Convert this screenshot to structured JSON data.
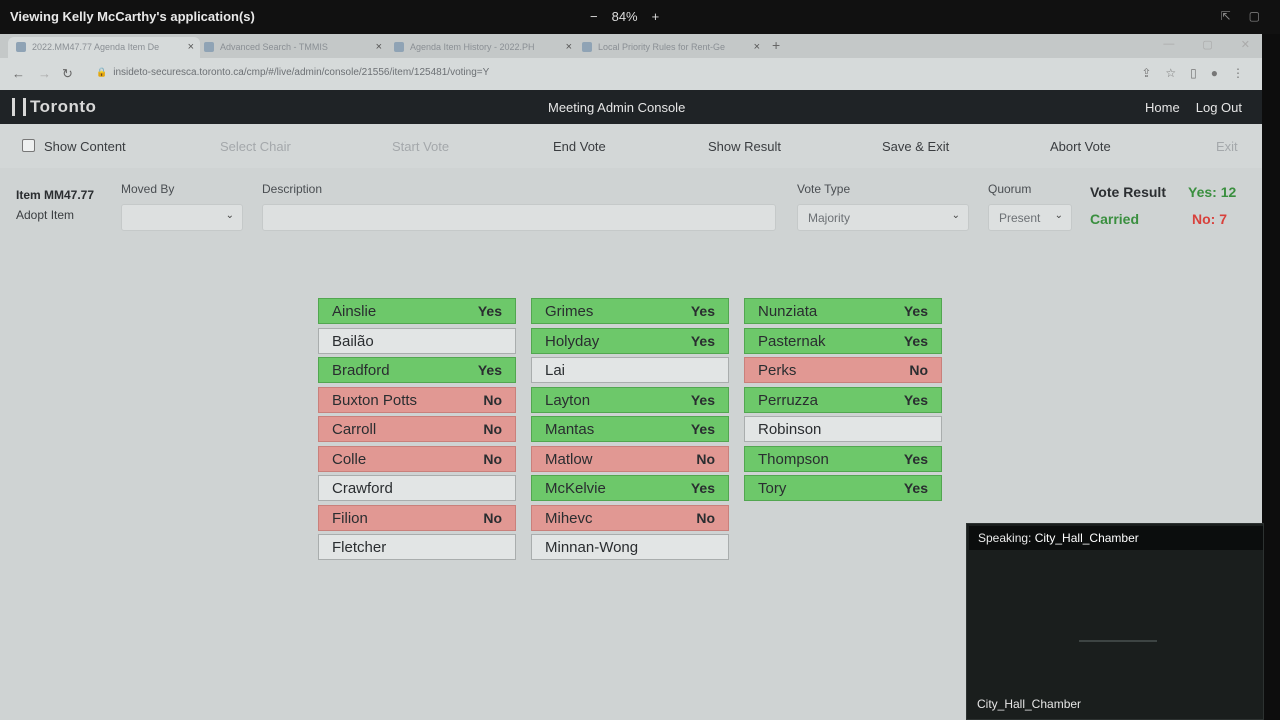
{
  "share": {
    "title": "Viewing Kelly McCarthy's application(s)",
    "zoom": "84%",
    "zoom_minus": "−",
    "zoom_plus": "+"
  },
  "browser": {
    "tabs": [
      {
        "label": "2022.MM47.77 Agenda Item De",
        "active": true
      },
      {
        "label": "Advanced Search - TMMIS",
        "active": false
      },
      {
        "label": "Agenda Item History - 2022.PH",
        "active": false
      },
      {
        "label": "Local Priority Rules for Rent-Ge",
        "active": false
      }
    ],
    "new_tab": "+",
    "url": "insideto-securesca.toronto.ca/cmp/#/live/admin/console/21556/item/125481/voting=Y"
  },
  "app": {
    "logo_text": "Toronto",
    "title": "Meeting Admin Console",
    "home_link": "Home",
    "logout_link": "Log Out"
  },
  "toolbar": {
    "show_content": "Show Content",
    "select_chair": "Select Chair",
    "start_vote": "Start Vote",
    "end_vote": "End Vote",
    "show_result": "Show Result",
    "save_exit": "Save & Exit",
    "abort_vote": "Abort Vote",
    "exit": "Exit"
  },
  "form": {
    "item_code": "Item MM47.77",
    "item_action": "Adopt Item",
    "moved_by_label": "Moved By",
    "moved_by_value": "",
    "description_label": "Description",
    "vote_type_label": "Vote Type",
    "vote_type_value": "Majority",
    "quorum_label": "Quorum",
    "quorum_value": "Present"
  },
  "result": {
    "label": "Vote Result",
    "status": "Carried",
    "yes": "Yes: 12",
    "no": "No: 7"
  },
  "votes": {
    "col1": [
      {
        "name": "Ainslie",
        "vote": "Yes"
      },
      {
        "name": "Bailão",
        "vote": ""
      },
      {
        "name": "Bradford",
        "vote": "Yes"
      },
      {
        "name": "Buxton Potts",
        "vote": "No"
      },
      {
        "name": "Carroll",
        "vote": "No"
      },
      {
        "name": "Colle",
        "vote": "No"
      },
      {
        "name": "Crawford",
        "vote": ""
      },
      {
        "name": "Filion",
        "vote": "No"
      },
      {
        "name": "Fletcher",
        "vote": ""
      }
    ],
    "col2": [
      {
        "name": "Grimes",
        "vote": "Yes"
      },
      {
        "name": "Holyday",
        "vote": "Yes"
      },
      {
        "name": "Lai",
        "vote": ""
      },
      {
        "name": "Layton",
        "vote": "Yes"
      },
      {
        "name": "Mantas",
        "vote": "Yes"
      },
      {
        "name": "Matlow",
        "vote": "No"
      },
      {
        "name": "McKelvie",
        "vote": "Yes"
      },
      {
        "name": "Mihevc",
        "vote": "No"
      },
      {
        "name": "Minnan-Wong",
        "vote": ""
      }
    ],
    "col3": [
      {
        "name": "Nunziata",
        "vote": "Yes"
      },
      {
        "name": "Pasternak",
        "vote": "Yes"
      },
      {
        "name": "Perks",
        "vote": "No"
      },
      {
        "name": "Perruzza",
        "vote": "Yes"
      },
      {
        "name": "Robinson",
        "vote": ""
      },
      {
        "name": "Thompson",
        "vote": "Yes"
      },
      {
        "name": "Tory",
        "vote": "Yes"
      }
    ]
  },
  "video": {
    "speaking_prefix": "Speaking:",
    "speaking_name": "City_Hall_Chamber",
    "caption": "City_Hall_Chamber"
  },
  "colors": {
    "yes": "#6dc86a",
    "no": "#e19893",
    "none": "#e2e5e5",
    "carried": "#3a8f3f",
    "no_count": "#d8413c"
  }
}
